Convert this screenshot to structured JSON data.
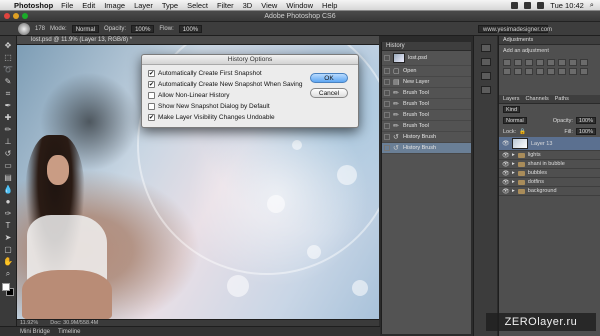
{
  "menubar": {
    "app_name": "Photoshop",
    "items": [
      "File",
      "Edit",
      "Image",
      "Layer",
      "Type",
      "Select",
      "Filter",
      "3D",
      "View",
      "Window",
      "Help"
    ],
    "clock": "Tue 10:42"
  },
  "window": {
    "title": "Adobe Photoshop CS6"
  },
  "options": {
    "brush_size": "178",
    "mode_label": "Mode:",
    "mode_value": "Normal",
    "opacity_label": "Opacity:",
    "opacity_value": "100%",
    "flow_label": "Flow:",
    "flow_value": "100%",
    "url": "www.yesimadesigner.com"
  },
  "document": {
    "tab_title": "lost.psd @ 11.9% (Layer 13, RGB/8) *",
    "zoom": "11.92%",
    "doc_size": "Doc: 30.9M/558.4M"
  },
  "bottom_tabs": [
    "Mini Bridge",
    "Timeline"
  ],
  "history": {
    "panel_title": "History",
    "snapshot": "lost.psd",
    "steps": [
      {
        "label": "Open",
        "icon": "document-icon"
      },
      {
        "label": "New Layer",
        "icon": "layer-icon"
      },
      {
        "label": "Brush Tool",
        "icon": "brush-icon"
      },
      {
        "label": "Brush Tool",
        "icon": "brush-icon"
      },
      {
        "label": "Brush Tool",
        "icon": "brush-icon"
      },
      {
        "label": "Brush Tool",
        "icon": "brush-icon"
      },
      {
        "label": "History Brush",
        "icon": "history-brush-icon"
      },
      {
        "label": "History Brush",
        "icon": "history-brush-icon"
      }
    ]
  },
  "dialog": {
    "title": "History Options",
    "options": [
      {
        "label": "Automatically Create First Snapshot",
        "checked": true
      },
      {
        "label": "Automatically Create New Snapshot When Saving",
        "checked": true
      },
      {
        "label": "Allow Non-Linear History",
        "checked": false
      },
      {
        "label": "Show New Snapshot Dialog by Default",
        "checked": false
      },
      {
        "label": "Make Layer Visibility Changes Undoable",
        "checked": true
      }
    ],
    "ok": "OK",
    "cancel": "Cancel"
  },
  "adjustments": {
    "tab": "Adjustments",
    "label": "Add an adjustment"
  },
  "layers": {
    "tabs": [
      "Layers",
      "Channels",
      "Paths"
    ],
    "kind": "Kind",
    "blend": "Normal",
    "opacity_label": "Opacity:",
    "opacity": "100%",
    "lock_label": "Lock:",
    "fill_label": "Fill:",
    "fill": "100%",
    "rows": [
      {
        "name": "Layer 13",
        "type": "layer"
      },
      {
        "name": "lights",
        "type": "group"
      },
      {
        "name": "shani in bubble",
        "type": "group"
      },
      {
        "name": "bubbles",
        "type": "group"
      },
      {
        "name": "dotfins",
        "type": "group"
      },
      {
        "name": "background",
        "type": "group"
      }
    ]
  },
  "watermark": "ZEROlayer.ru"
}
